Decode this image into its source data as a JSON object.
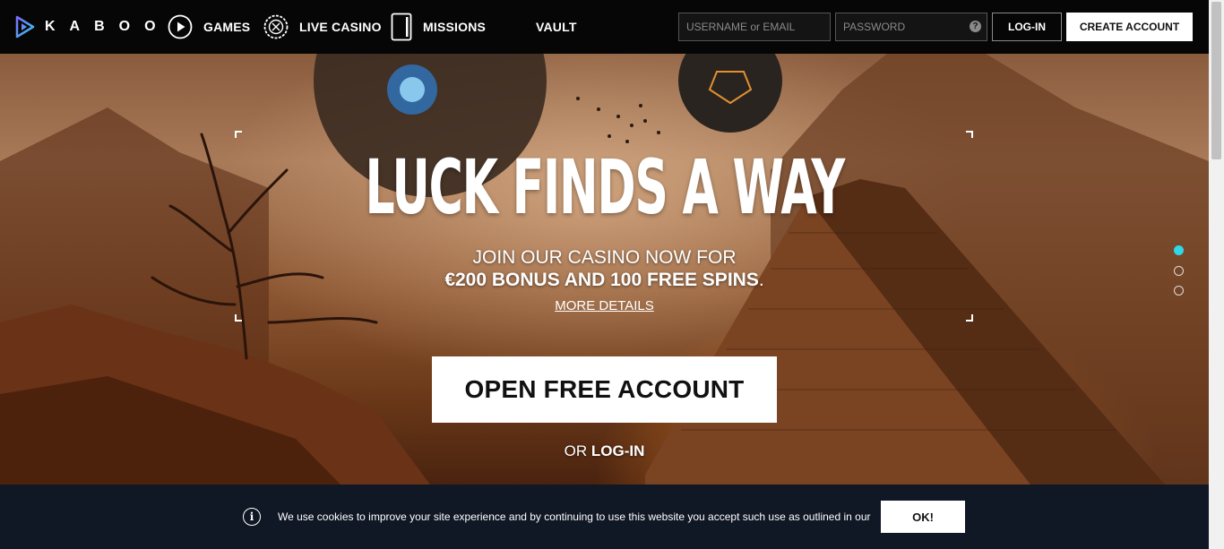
{
  "brand": {
    "name": "KABOO"
  },
  "nav": [
    {
      "label": "GAMES",
      "icon": "play-circle-icon"
    },
    {
      "label": "LIVE CASINO",
      "icon": "roulette-wheel-icon"
    },
    {
      "label": "MISSIONS",
      "icon": "phone-card-icon"
    },
    {
      "label": "VAULT",
      "icon": ""
    }
  ],
  "auth": {
    "username_placeholder": "USERNAME or EMAIL",
    "password_placeholder": "PASSWORD",
    "help_glyph": "?",
    "login_label": "LOG-IN",
    "create_label": "CREATE ACCOUNT"
  },
  "hero": {
    "headline": "LUCK FINDS A WAY",
    "subline": "JOIN OUR CASINO NOW FOR",
    "offer": "€200 BONUS AND 100 FREE SPINS",
    "offer_suffix": ".",
    "more_details": "MORE DETAILS",
    "cta_label": "OPEN FREE ACCOUNT",
    "or_text": "OR",
    "login_link": "LOG-IN",
    "slides": 3,
    "active_slide": 1,
    "accent_color": "#2fd8e8"
  },
  "cookie": {
    "text": "We use cookies to improve your site experience and by continuing to use this website you accept such use as outlined in our",
    "ok_label": "OK!",
    "background": "#101725"
  }
}
